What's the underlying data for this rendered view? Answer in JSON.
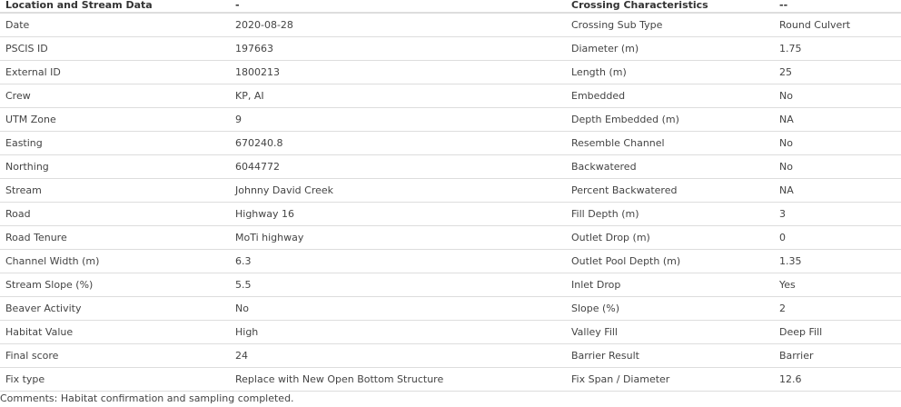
{
  "table": {
    "headers": [
      "Location and Stream Data",
      "-",
      "Crossing Characteristics",
      "--"
    ],
    "rows": [
      [
        "Date",
        "2020-08-28",
        "Crossing Sub Type",
        "Round Culvert"
      ],
      [
        "PSCIS ID",
        "197663",
        "Diameter (m)",
        "1.75"
      ],
      [
        "External ID",
        "1800213",
        "Length (m)",
        "25"
      ],
      [
        "Crew",
        "KP, AI",
        "Embedded",
        "No"
      ],
      [
        "UTM Zone",
        "9",
        "Depth Embedded (m)",
        "NA"
      ],
      [
        "Easting",
        "670240.8",
        "Resemble Channel",
        "No"
      ],
      [
        "Northing",
        "6044772",
        "Backwatered",
        "No"
      ],
      [
        "Stream",
        "Johnny David Creek",
        "Percent Backwatered",
        "NA"
      ],
      [
        "Road",
        "Highway 16",
        "Fill Depth (m)",
        "3"
      ],
      [
        "Road Tenure",
        "MoTi highway",
        "Outlet Drop (m)",
        "0"
      ],
      [
        "Channel Width (m)",
        "6.3",
        "Outlet Pool Depth (m)",
        "1.35"
      ],
      [
        "Stream Slope (%)",
        "5.5",
        "Inlet Drop",
        "Yes"
      ],
      [
        "Beaver Activity",
        "No",
        "Slope (%)",
        "2"
      ],
      [
        "Habitat Value",
        "High",
        "Valley Fill",
        "Deep Fill"
      ],
      [
        "Final score",
        "24",
        "Barrier Result",
        "Barrier"
      ],
      [
        "Fix type",
        "Replace with New Open Bottom Structure",
        "Fix Span / Diameter",
        "12.6"
      ]
    ]
  },
  "comments": "Comments: Habitat confirmation and sampling completed."
}
